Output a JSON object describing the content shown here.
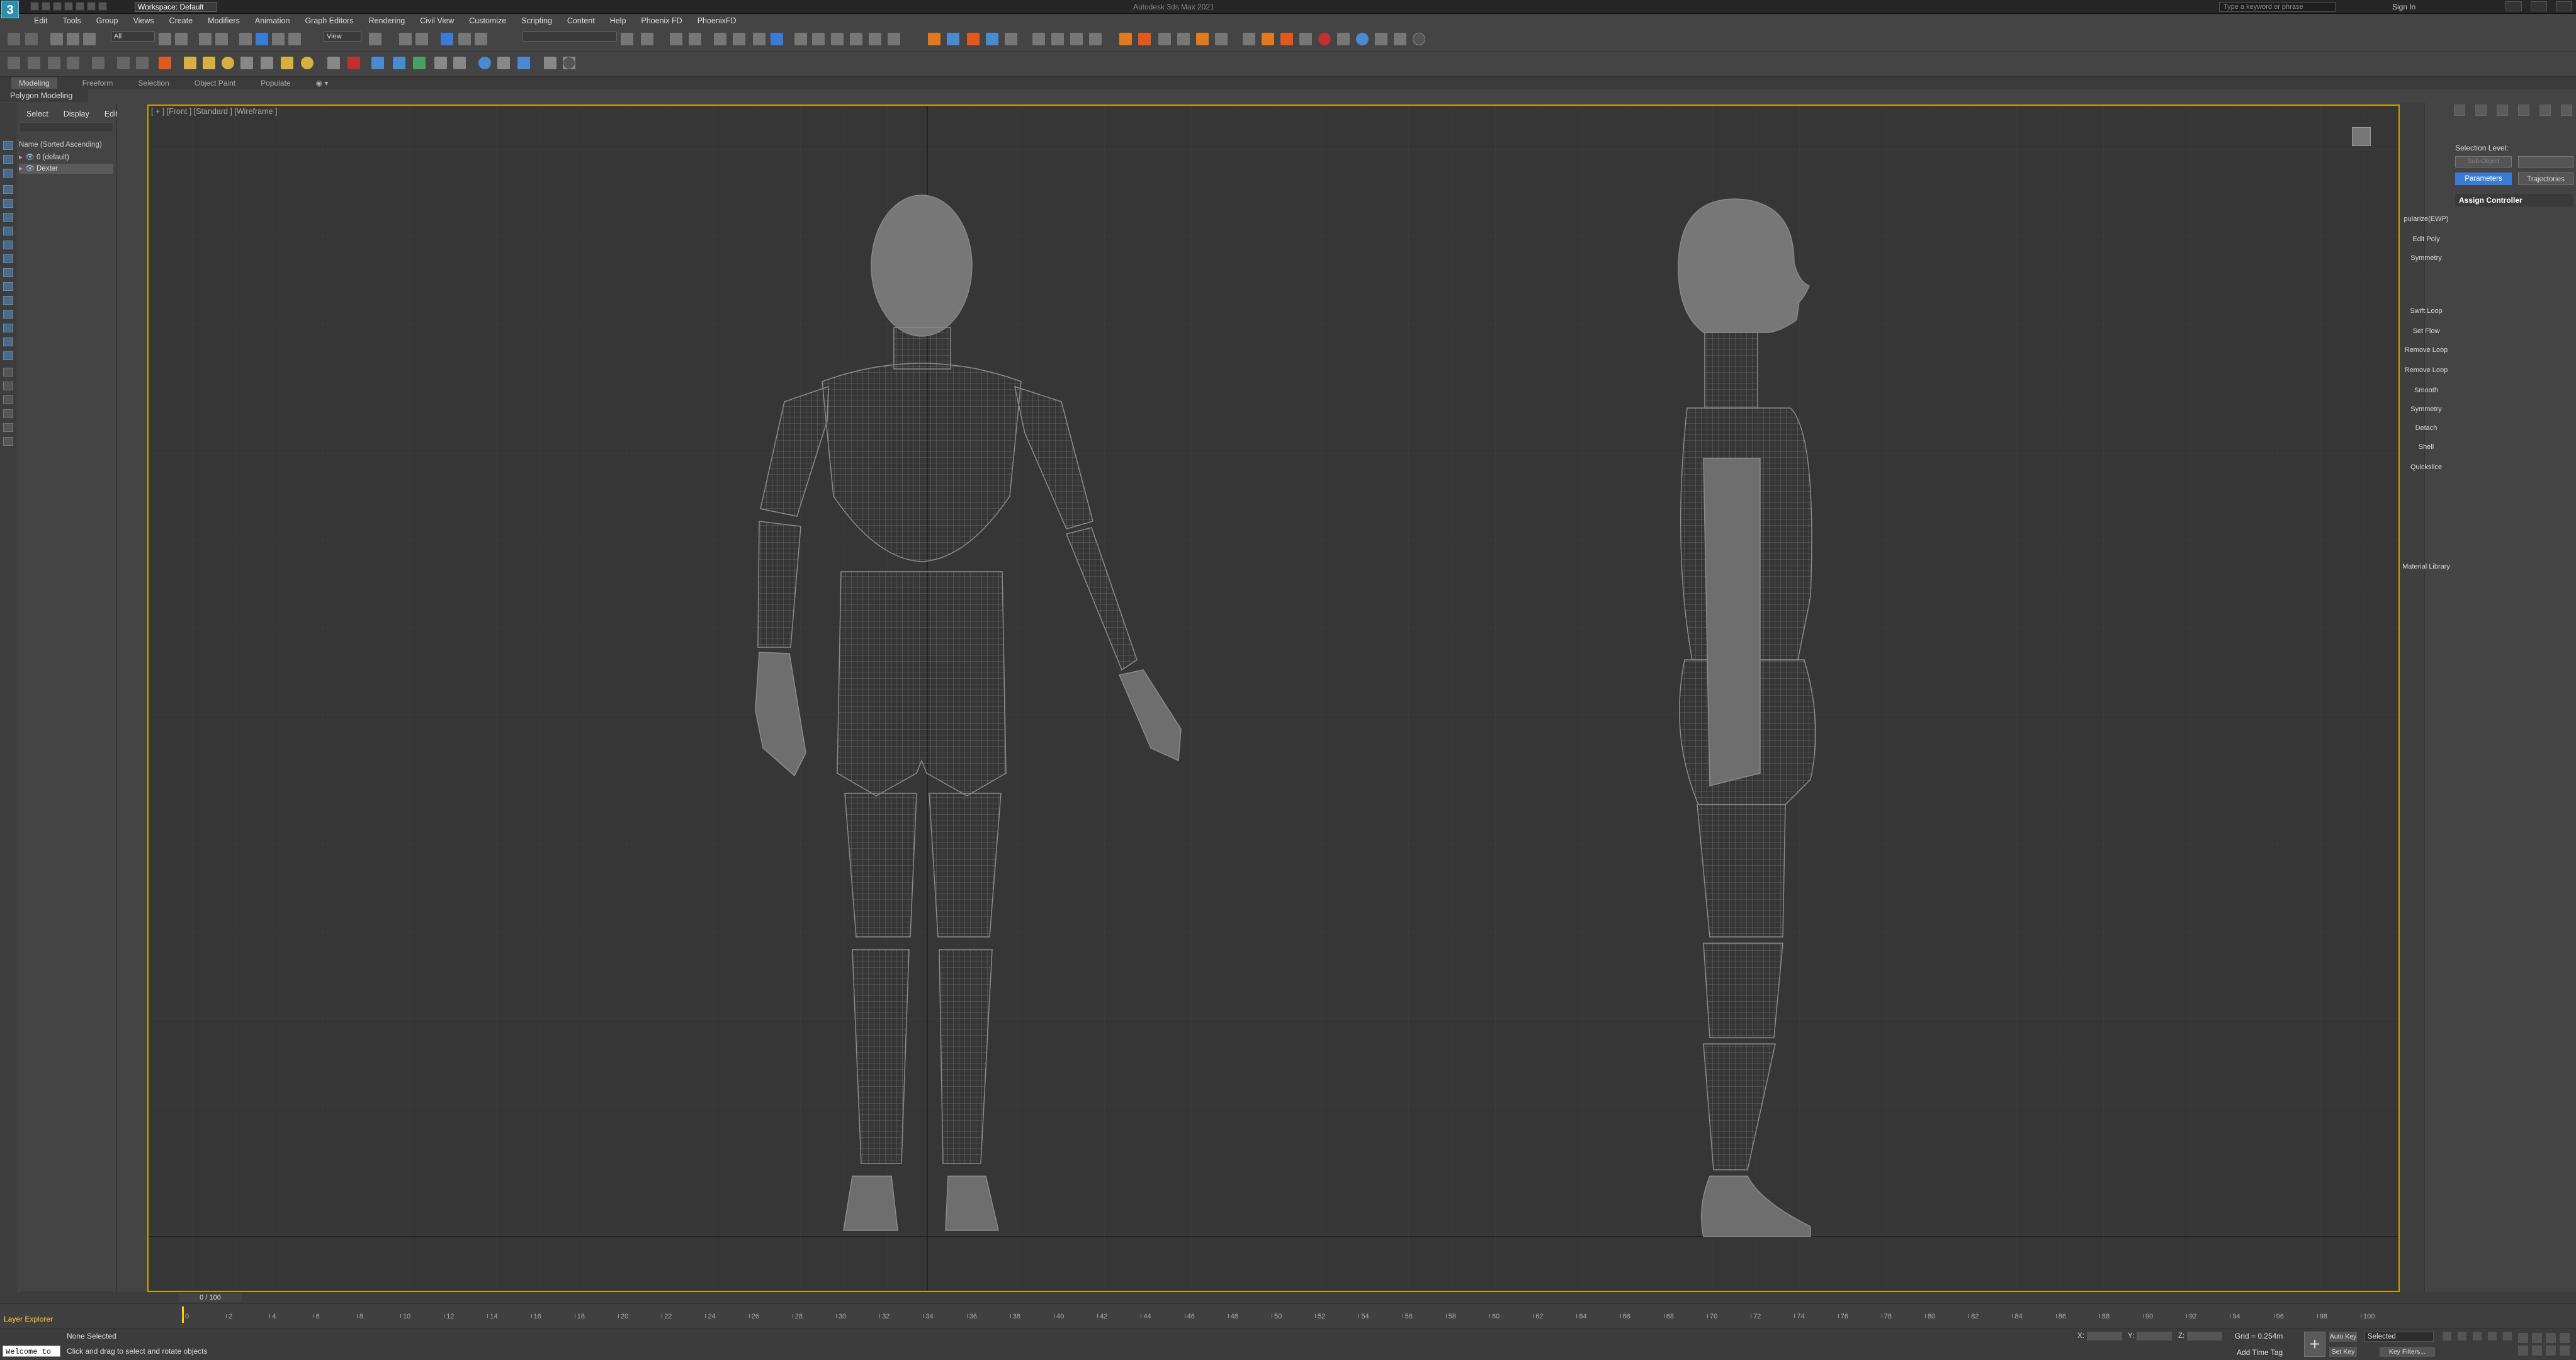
{
  "titlebar": {
    "app_icon_letter": "3",
    "workspace": "Workspace: Default",
    "title": "Autodesk 3ds Max 2021",
    "search_placeholder": "Type a keyword or phrase",
    "signin_label": "Sign In"
  },
  "menu": [
    "Edit",
    "Tools",
    "Group",
    "Views",
    "Create",
    "Modifiers",
    "Animation",
    "Graph Editors",
    "Rendering",
    "Civil View",
    "Customize",
    "Scripting",
    "Content",
    "Help",
    "Phoenix FD",
    "PhoenixFD"
  ],
  "toolbar": {
    "selection_filter": "All",
    "ref_coord": "View",
    "named_selection": ""
  },
  "ribbon": {
    "tabs": [
      "Modeling",
      "Freeform",
      "Selection",
      "Object Paint",
      "Populate"
    ],
    "active_tab": "Modeling",
    "subpanel": "Polygon Modeling"
  },
  "scene_explorer": {
    "tabs": [
      "Select",
      "Display",
      "Edit"
    ],
    "header": "Name (Sorted Ascending)",
    "items": [
      {
        "label": "0 (default)"
      },
      {
        "label": "Dexter"
      }
    ]
  },
  "viewport": {
    "label": "[ + ] [Front ] [Standard ] [Wireframe ]"
  },
  "command_panel": {
    "modifiers": [
      "pularize(EWP)",
      "Edit Poly",
      "Symmetry",
      "Swift Loop",
      "Set Flow",
      "Remove Loop",
      "Remove Loop",
      "Smooth",
      "Symmetry",
      "Detach",
      "Shell",
      "Quickslice",
      "Material Library"
    ],
    "selection_level_label": "Selection Level:",
    "sub_object_placeholder": "Sub-Object",
    "parameters_label": "Parameters",
    "trajectories_label": "Trajectories",
    "assign_controller_label": "Assign Controller"
  },
  "timeline": {
    "frame_display": "0 / 100",
    "ticks": [
      "0",
      "2",
      "4",
      "6",
      "8",
      "10",
      "12",
      "14",
      "16",
      "18",
      "20",
      "22",
      "24",
      "26",
      "28",
      "30",
      "32",
      "34",
      "36",
      "38",
      "40",
      "42",
      "44",
      "46",
      "48",
      "50",
      "52",
      "54",
      "56",
      "58",
      "60",
      "62",
      "64",
      "66",
      "68",
      "70",
      "72",
      "74",
      "76",
      "78",
      "80",
      "82",
      "84",
      "86",
      "88",
      "90",
      "92",
      "94",
      "96",
      "98",
      "100"
    ],
    "current_frame": 0
  },
  "status": {
    "layer_explorer": "Layer Explorer",
    "maxscript": "Welcome to M",
    "selection": "None Selected",
    "prompt": "Click and drag to select and rotate objects",
    "x_label": "X:",
    "y_label": "Y:",
    "z_label": "Z:",
    "grid": "Grid = 0.254m",
    "add_time_tag": "Add Time Tag",
    "auto_key": "Auto Key",
    "set_key": "Set Key",
    "selected_dd": "Selected",
    "key_filters": "Key Filters..."
  },
  "colors": {
    "viewport_bg": "#363636",
    "viewport_border": "#c8a200",
    "accent_blue": "#3a7bd5",
    "wire": "#8c8c8c",
    "layer_label": "#ffcc33"
  }
}
